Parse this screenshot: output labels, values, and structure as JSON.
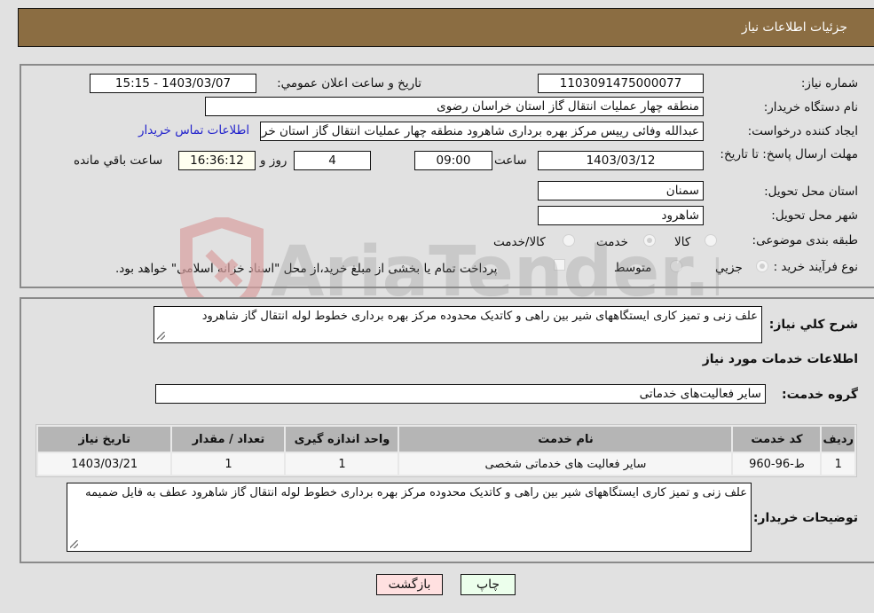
{
  "header": {
    "title": "جزئیات اطلاعات نیاز"
  },
  "form": {
    "need_number": {
      "label": "شماره نیاز:",
      "value": "1103091475000077"
    },
    "announce_datetime": {
      "label": "تاریخ و ساعت اعلان عمومي:",
      "value": "1403/03/07 - 15:15"
    },
    "buyer_org": {
      "label": "نام دستگاه خريدار:",
      "value": "منطقه چهار عملیات انتقال گاز   استان خراسان رضوی"
    },
    "requester": {
      "label": "ايجاد کننده درخواست:",
      "value": "عبدالله وفائی رییس مرکز بهره برداری شاهرود منطقه چهار عملیات انتقال گاز   استان خراسان رضوی"
    },
    "contact_link": "اطلاعات تماس خريدار",
    "deadline": {
      "label": "مهلت ارسال پاسخ: تا تاریخ:",
      "date": "1403/03/12",
      "time_label": "ساعت",
      "time": "09:00",
      "days": "4",
      "days_suffix": "روز و",
      "remaining": "16:36:12",
      "remaining_suffix": "ساعت باقي مانده"
    },
    "delivery_province": {
      "label": "استان محل تحویل:",
      "value": "سمنان"
    },
    "delivery_city": {
      "label": "شهر محل تحویل:",
      "value": "شاهرود"
    },
    "category": {
      "label": "طبقه بندی موضوعی:",
      "options": [
        "کالا",
        "خدمت",
        "کالا/خدمت"
      ],
      "selected": "خدمت"
    },
    "purchase_process": {
      "label": "نوع فرآيند خريد :",
      "options": [
        "جزيي",
        "متوسط"
      ],
      "selected": "جزيي",
      "treasury_note": "پرداخت تمام يا بخشی از مبلغ خريد،از محل \"اسناد خزانه اسلامی\" خواهد بود.",
      "treasury_checked": false
    }
  },
  "details": {
    "summary_label": "شرح كلي نياز:",
    "summary": "علف زنی و تمیز کاری ایستگاههای شیر بین راهی و کاتدیک محدوده مرکز بهره برداری خطوط لوله انتقال گاز شاهرود",
    "services_heading": "اطلاعات خدمات مورد نياز",
    "service_group_label": "گروه خدمت:",
    "service_group": "سایر فعالیت‌های خدماتی",
    "table": {
      "headers": [
        "رديف",
        "کد خدمت",
        "نام خدمت",
        "واحد اندازه گيری",
        "تعداد / مقدار",
        "تاريخ نياز"
      ],
      "rows": [
        [
          "1",
          "ط-96-960",
          "سایر فعالیت های خدماتی شخصی",
          "1",
          "1",
          "1403/03/21"
        ]
      ]
    },
    "buyer_notes_label": "توضيحات خريدار:",
    "buyer_notes": "علف زنی و تمیز کاری ایستگاههای شیر بین راهی و کاتدیک محدوده مرکز بهره برداری خطوط لوله انتقال گاز شاهرود  عطف به فایل ضمیمه"
  },
  "buttons": {
    "print": "چاپ",
    "back": "بازگشت"
  },
  "watermark": {
    "text": "AriaTender.neT"
  },
  "colors": {
    "header_bg": "#8b6d42",
    "link": "#2222cc",
    "back_bg": "#ffe0e0",
    "print_bg": "#ecffec"
  }
}
